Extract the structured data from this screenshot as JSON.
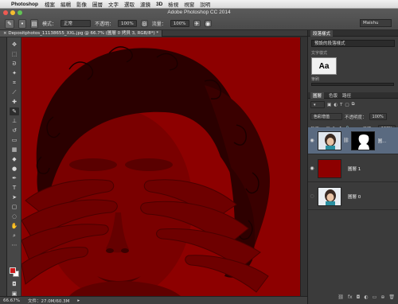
{
  "menubar": {
    "app": "Photoshop",
    "items": [
      "檔案",
      "編輯",
      "影像",
      "圖層",
      "文字",
      "選取",
      "濾鏡",
      "3D",
      "檢視",
      "視窗",
      "說明"
    ]
  },
  "window": {
    "title": "Adobe Photoshop CC 2014"
  },
  "options": {
    "mode_label": "模式：",
    "mode_value": "正常",
    "opacity_label": "不透明：",
    "opacity_value": "100%",
    "flow_label": "流量：",
    "flow_value": "100%",
    "workspace": "Maishu"
  },
  "document": {
    "tab_label": "Depositphotos_11138655_XXL.jpg @ 66.7% (圖層 0 拷貝 3, RGB/8*) *",
    "zoom": "66.67%",
    "file_info": "文件：27.0M/60.3M"
  },
  "panels": {
    "character_tab": "段落樣式",
    "preset_select": "預設的段落樣式",
    "text_style_label": "文字樣式",
    "aa_sample": "Aa",
    "brush_label": "筆刷",
    "layers_tab": "圖層",
    "channels_tab": "色版",
    "paths_tab": "路徑",
    "blend_mode": "色彩增值",
    "opacity_label": "不透明度：",
    "opacity_value": "100%",
    "lock_label": "鎖定：",
    "fill_label": "填滿：",
    "fill_value": "100%"
  },
  "layers": [
    {
      "name": "圖...",
      "active": true
    },
    {
      "name": "圖層 1",
      "active": false
    },
    {
      "name": "圖層 0",
      "active": false
    }
  ],
  "colors": {
    "canvas_red": "#8d0000",
    "foreground": "#cc1a1a",
    "background": "#ffffff",
    "selected_layer": "#5a6a80"
  }
}
